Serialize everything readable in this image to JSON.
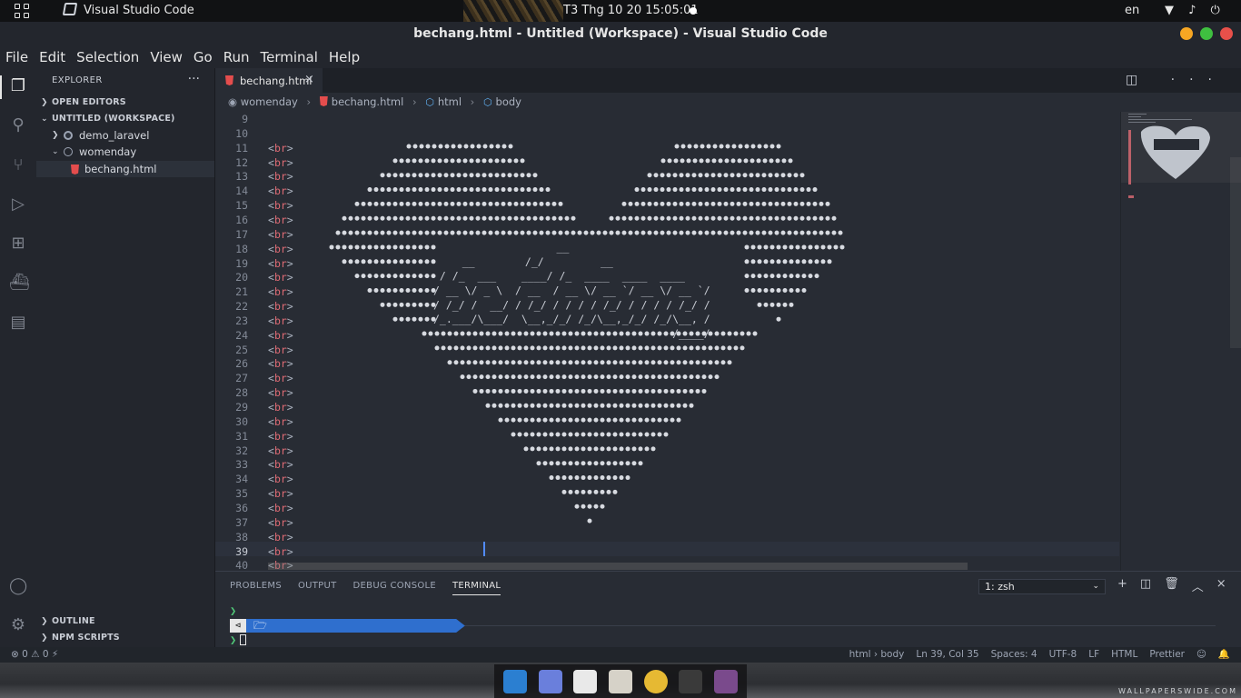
{
  "topbar": {
    "app_name": "Visual Studio Code",
    "clock": "T3 Thg 10 20  15:05:01",
    "lang": "en",
    "tray_icons": "▼ ♪ ⏻"
  },
  "window": {
    "title": "bechang.html - Untitled (Workspace) - Visual Studio Code",
    "controls": {
      "minimize": "#f6a623",
      "maximize": "#3fc040",
      "close": "#e8504a"
    }
  },
  "menu": [
    "File",
    "Edit",
    "Selection",
    "View",
    "Go",
    "Run",
    "Terminal",
    "Help"
  ],
  "activity_icons": {
    "explorer": "❐",
    "search": "⚲",
    "source_control": "⑂",
    "run_debug": "▷",
    "extensions": "⊞",
    "docker": "⛴",
    "notebook": "▤",
    "account": "◯",
    "settings": "⚙"
  },
  "sidebar": {
    "title": "EXPLORER",
    "more": "···",
    "sections": {
      "open_editors": "OPEN EDITORS",
      "workspace": "UNTITLED (WORKSPACE)",
      "outline": "OUTLINE",
      "npm_scripts": "NPM SCRIPTS"
    },
    "tree": [
      {
        "label": "demo_laravel",
        "expanded": false
      },
      {
        "label": "womenday",
        "expanded": true
      },
      {
        "label": "bechang.html",
        "selected": true
      }
    ]
  },
  "tabs": [
    {
      "label": "bechang.html",
      "close": "×",
      "active": true
    }
  ],
  "editor_actions": "◫ ···",
  "breadcrumb": [
    "womenday",
    "bechang.html",
    "html",
    "body"
  ],
  "editor": {
    "first_line": 9,
    "last_line": 40,
    "tag": "br",
    "tag_start_line": 11,
    "current_line": 39,
    "heart_glyph": "♥",
    "heart_color": "#d7dae0"
  },
  "panel": {
    "tabs": [
      "PROBLEMS",
      "OUTPUT",
      "DEBUG CONSOLE",
      "TERMINAL"
    ],
    "active_tab": "TERMINAL",
    "terminal_select": "1: zsh",
    "actions": [
      "+",
      "◫",
      "🗑",
      "︿",
      "×"
    ],
    "prompt": "❯",
    "path_prefix": "⊲",
    "path_folder_icon": "🗁",
    "path": "/opt/lampp/htdocs/",
    "path_bold": "demo_laravel"
  },
  "status": {
    "left": "⊗ 0  ⚠ 0   ⚡",
    "right": [
      "html › body",
      "Ln 39, Col 35",
      "Spaces: 4",
      "UTF-8",
      "LF",
      "HTML",
      "Prettier",
      "☺",
      "🔔"
    ]
  },
  "dock_apps": [
    {
      "name": "vscode",
      "color": "#2b7fd1"
    },
    {
      "name": "screenshot",
      "color": "#6a7fdc"
    },
    {
      "name": "text-editor",
      "color": "#e9e9e9"
    },
    {
      "name": "files",
      "color": "#d6d2c8"
    },
    {
      "name": "chrome",
      "color": "#e6b933"
    },
    {
      "name": "terminal",
      "color": "#3a3a3a"
    },
    {
      "name": "java-ee-ide",
      "color": "#7a4a8c"
    }
  ],
  "wallpaper_credit": "WALLPAPERSWIDE.COM"
}
